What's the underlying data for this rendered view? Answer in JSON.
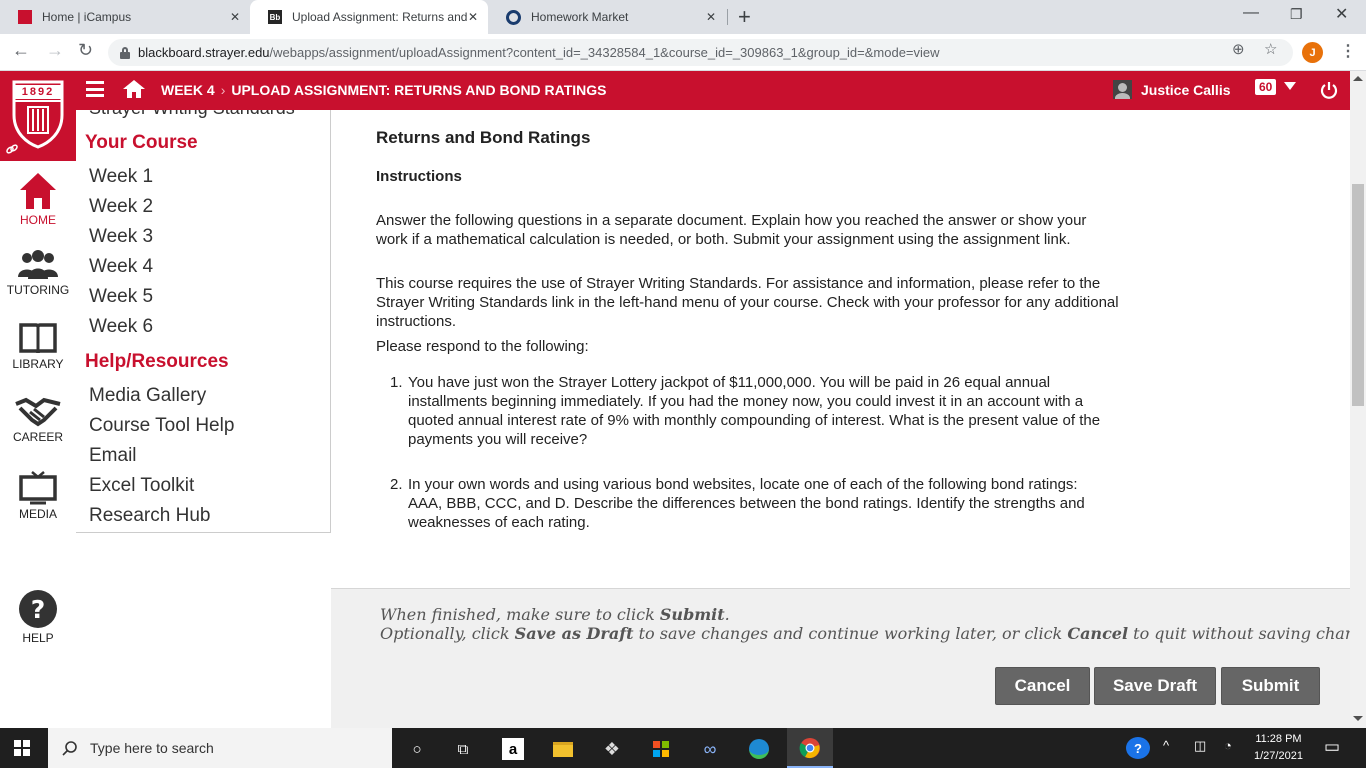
{
  "browser": {
    "tabs": [
      {
        "title": "Home | iCampus",
        "favicon": "icampus-favicon",
        "active": false
      },
      {
        "title": "Upload Assignment: Returns and",
        "favicon": "blackboard-favicon",
        "favicon_text": "Bb",
        "active": true
      },
      {
        "title": "Homework Market",
        "favicon": "homework-market-favicon",
        "active": false
      }
    ],
    "url_host": "blackboard.strayer.edu",
    "url_path": "/webapps/assignment/uploadAssignment?content_id=_34328584_1&course_id=_309863_1&group_id=&mode=view",
    "profile_initial": "J"
  },
  "header": {
    "logo_year": "1892",
    "breadcrumb": [
      "WEEK 4",
      "UPLOAD ASSIGNMENT: RETURNS AND BOND RATINGS"
    ],
    "user_name": "Justice Callis",
    "notification_count": "60",
    "brand_color": "#c8102e"
  },
  "leftnav": {
    "items": [
      {
        "label": "HOME",
        "icon": "home-icon"
      },
      {
        "label": "TUTORING",
        "icon": "people-icon"
      },
      {
        "label": "LIBRARY",
        "icon": "book-icon"
      },
      {
        "label": "CAREER",
        "icon": "handshake-icon"
      },
      {
        "label": "MEDIA",
        "icon": "monitor-icon"
      },
      {
        "label": "HELP",
        "icon": "help-icon"
      }
    ]
  },
  "coursemenu": {
    "cut_text": "Strayer Writing Standards",
    "section1": "Your Course",
    "weeks": [
      "Week 1",
      "Week 2",
      "Week 3",
      "Week 4",
      "Week 5",
      "Week 6"
    ],
    "section2": "Help/Resources",
    "resources": [
      "Media Gallery",
      "Course Tool Help",
      "Email",
      "Excel Toolkit",
      "Research Hub"
    ]
  },
  "content": {
    "title": "Returns and Bond Ratings",
    "subtitle": "Instructions",
    "para1": "Answer the following questions in a separate document. Explain how you reached the answer or show your work if a mathematical calculation is needed, or both. Submit your assignment using the assignment link.",
    "para2": "This course requires the use of Strayer Writing Standards. For assistance and information, please refer to the Strayer Writing Standards link in the left-hand menu of your course. Check with your professor for any additional instructions.",
    "para3": "Please respond to the following:",
    "questions": [
      {
        "num": "1.",
        "text": "You have just won the Strayer Lottery jackpot of $11,000,000. You will be paid in 26 equal annual installments beginning immediately. If you had the money now, you could invest it in an account with a quoted annual interest rate of 9% with monthly compounding of interest. What is the present value of the payments you will receive?"
      },
      {
        "num": "2.",
        "text": "In your own words and using various bond websites, locate one of each of the following bond ratings: AAA, BBB, CCC, and D. Describe the differences between the bond ratings. Identify the strengths and weaknesses of each rating."
      }
    ]
  },
  "footer": {
    "line1_pre": "When finished, make sure to click ",
    "line1_b": "Submit",
    "line1_post": ".",
    "line2_pre": "Optionally, click ",
    "line2_b1": "Save as Draft",
    "line2_mid": " to save changes and continue working later, or click ",
    "line2_b2": "Cancel",
    "line2_post": " to quit without saving changes.",
    "cancel_label": "Cancel",
    "save_draft_label": "Save Draft",
    "submit_label": "Submit"
  },
  "taskbar": {
    "search_placeholder": "Type here to search",
    "time": "11:28 PM",
    "date": "1/27/2021"
  }
}
